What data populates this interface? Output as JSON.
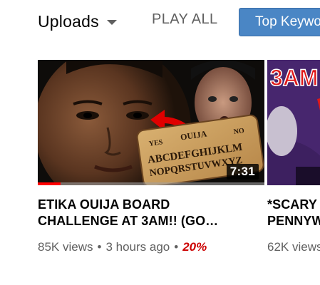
{
  "header": {
    "uploads_label": "Uploads",
    "play_all_label": "PLAY ALL",
    "top_keywords_label": "Top Keywords"
  },
  "videos": [
    {
      "title": "ETIKA OUIJA BOARD\nCHALLENGE AT 3AM!! (GO…",
      "duration": "7:31",
      "views": "85K views",
      "age": "3 hours ago",
      "percent": "20%",
      "watched_fraction": 0.1,
      "thumbnail_text_yes": "YES",
      "thumbnail_text_ouija": "OUIJA",
      "thumbnail_text_no": "NO",
      "thumbnail_text_row1": "ABCDEFGHIJKLM",
      "thumbnail_text_row2": "NOPQRSTUVWXYZ"
    },
    {
      "title": "*SCARY\nPENNYW",
      "views": "62K views",
      "thumbnail_text": "3AM"
    }
  ]
}
